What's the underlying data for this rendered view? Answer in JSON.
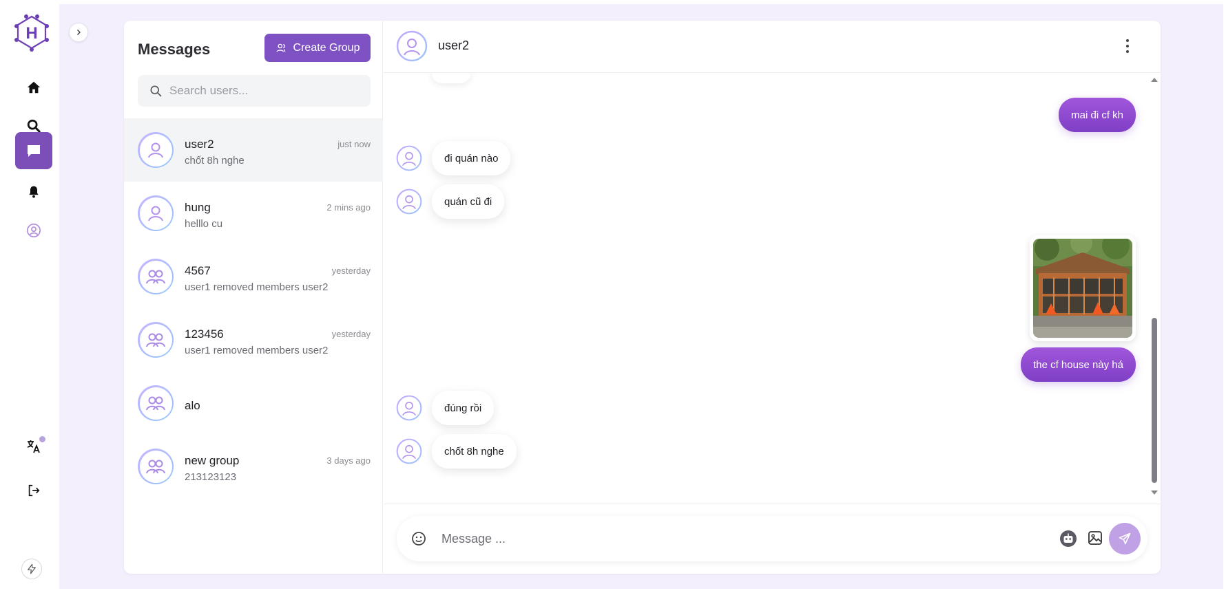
{
  "app": {
    "logo_letter": "H",
    "accent_color": "#7e52c2"
  },
  "rail": {
    "items": [
      {
        "icon": "home-icon"
      },
      {
        "icon": "search-icon"
      },
      {
        "icon": "chat-icon",
        "active": true
      },
      {
        "icon": "bell-icon"
      },
      {
        "icon": "user-circle-icon"
      }
    ],
    "bottom": [
      {
        "icon": "translate-icon"
      },
      {
        "icon": "logout-icon"
      }
    ]
  },
  "sidebar": {
    "title": "Messages",
    "create_group_label": "Create Group",
    "search_placeholder": "Search users...",
    "conversations": [
      {
        "name": "user2",
        "preview": "chốt 8h nghe",
        "time": "just now",
        "type": "user",
        "selected": true
      },
      {
        "name": "hung",
        "preview": "helllo cu",
        "time": "2 mins ago",
        "type": "user"
      },
      {
        "name": "4567",
        "preview": "user1 removed members user2",
        "time": "yesterday",
        "type": "group"
      },
      {
        "name": "123456",
        "preview": "user1 removed members user2",
        "time": "yesterday",
        "type": "group"
      },
      {
        "name": "alo",
        "preview": "",
        "time": "",
        "type": "group"
      },
      {
        "name": "new group",
        "preview": "213123123",
        "time": "3 days ago",
        "type": "group"
      }
    ]
  },
  "chat": {
    "contact_name": "user2",
    "messages": [
      {
        "direction": "out",
        "text": "mai đi cf kh"
      },
      {
        "direction": "in",
        "text": "đi quán nào"
      },
      {
        "direction": "in",
        "text": "quán cũ đi"
      },
      {
        "direction": "out",
        "type": "image",
        "image": "cafe-photo"
      },
      {
        "direction": "out",
        "text": "the cf house này há"
      },
      {
        "direction": "in",
        "text": "đúng rồi"
      },
      {
        "direction": "in",
        "text": "chốt 8h nghe"
      }
    ],
    "composer_placeholder": "Message ..."
  }
}
